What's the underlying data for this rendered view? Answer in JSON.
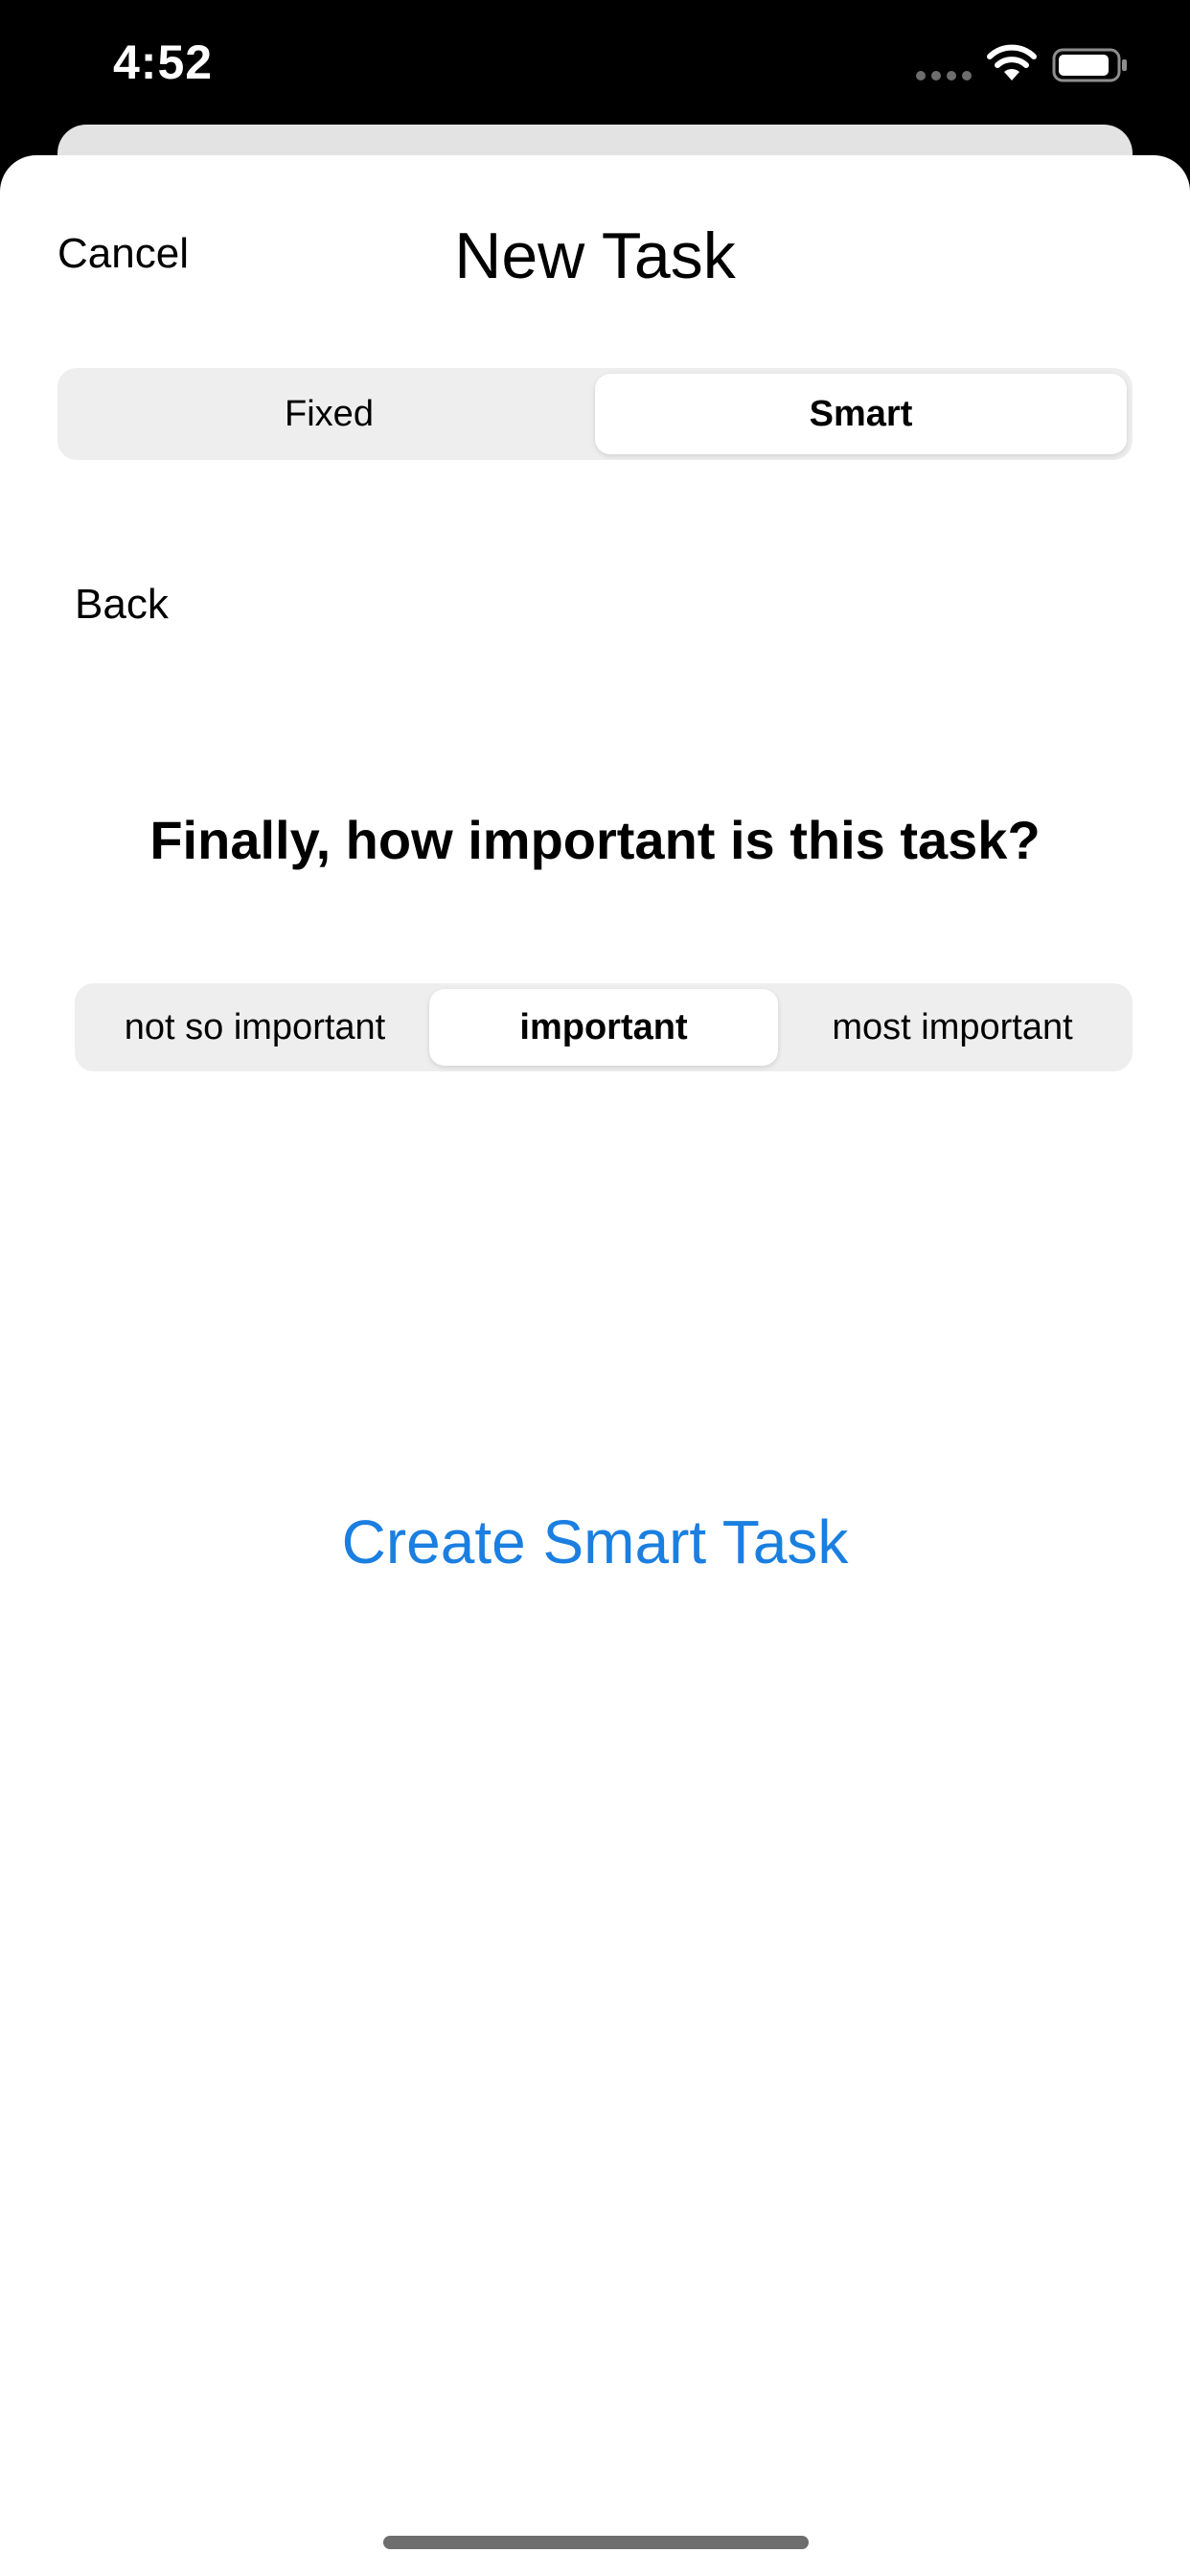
{
  "status_bar": {
    "time": "4:52"
  },
  "nav": {
    "cancel_label": "Cancel",
    "title": "New Task"
  },
  "mode_segment": {
    "options": [
      "Fixed",
      "Smart"
    ],
    "selected": "Smart"
  },
  "back_label": "Back",
  "question": "Finally, how important is this task?",
  "importance_segment": {
    "options": [
      "not so important",
      "important",
      "most important"
    ],
    "selected": "important"
  },
  "create_button_label": "Create Smart Task",
  "colors": {
    "accent": "#1a7fe0",
    "segment_bg": "#eeeeef",
    "status_bar_bg": "#000000"
  },
  "icons": [
    "wifi-icon",
    "battery-icon",
    "signal-dots-icon"
  ]
}
